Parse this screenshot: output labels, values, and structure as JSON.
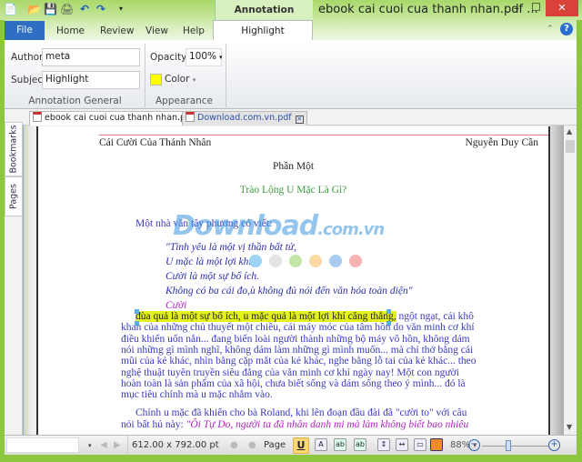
{
  "window": {
    "title": "ebook cai cuoi cua thanh nhan.pdf ...",
    "context_tab": "Annotation Properties"
  },
  "ribbon": {
    "tabs": [
      "File",
      "Home",
      "Review",
      "View",
      "Help",
      "Highlight Annotation"
    ],
    "author_label": "Author",
    "author_value": "meta",
    "subject_label": "Subject",
    "subject_value": "Highlight",
    "group_general": "Annotation General",
    "opacity_label": "Opacity",
    "opacity_value": "100%",
    "color_label": "Color",
    "color_value": "#ffff00",
    "group_appearance": "Appearance"
  },
  "doc_tabs": [
    "ebook cai cuoi cua thanh nhan.pdf",
    "Download.com.vn.pdf"
  ],
  "side_tabs": [
    "Bookmarks",
    "Pages"
  ],
  "page": {
    "header_left": "Cái Cười Của Thánh Nhân",
    "header_right": "Nguyễn Duy Cần",
    "part": "Phần Một",
    "chapter": "Trào Lộng U Mặc Là Gì?",
    "intro": "Một nhà văn tây phương có viết:",
    "quote": [
      "\"Tình yêu là một vị thần bất tử,",
      "U mặc là một lợi khí,",
      "Cười là một sự bổ ích.",
      "Không có ba cái đo,ù không đủ nói đến văn hóa toàn diện\""
    ],
    "quote_end": "Cười",
    "highlighted": "đùa quả là một sự bổ ích, u mặc quả là một lợi khí căng thẳng,",
    "para1_first_rest": " ngột ngạt, cái khô",
    "para1": [
      "khan của những chủ thuyết một chiều, cái máy móc của tâm hồn do văn minh cơ khí",
      "điều khiển uốn nắn... đang biến loài người thành những bộ máy vô hồn, không dám",
      "nói những gì mình nghĩ, không dám làm những gì mình muốn... mà chỉ thở bằng cái",
      "mũi của kẻ khác, nhìn bằng cặp mắt của kẻ khác, nghe bằng lỗ tai của kẻ khác... theo",
      "nghệ thuật tuyên truyền siêu đẳng của văn minh cơ khí ngày nay! Một con người",
      "hoàn toàn là sản phẩm của xã hội, chưa biết sống và dám sống theo ý mình... đó là",
      "mục tiêu chính mà u mặc nhắm vào."
    ],
    "para2": "Chính u mặc đã khiến cho bà Roland, khi lên đoạn đầu đài đã \"cười to\" với câu",
    "para2_next_plain": "nói bất hủ này: ",
    "para2_next_ital": "\"Ôi Tự Do, người ta đã nhân danh mi mà làm không biết bao nhiêu",
    "watermark": "Download.com.vn",
    "highlight_color": "#e3f21c"
  },
  "status": {
    "page_size": "612.00 x 792.00 pt",
    "page_label": "Page",
    "zoom": "88%",
    "zoom_slider_percent": 40
  }
}
